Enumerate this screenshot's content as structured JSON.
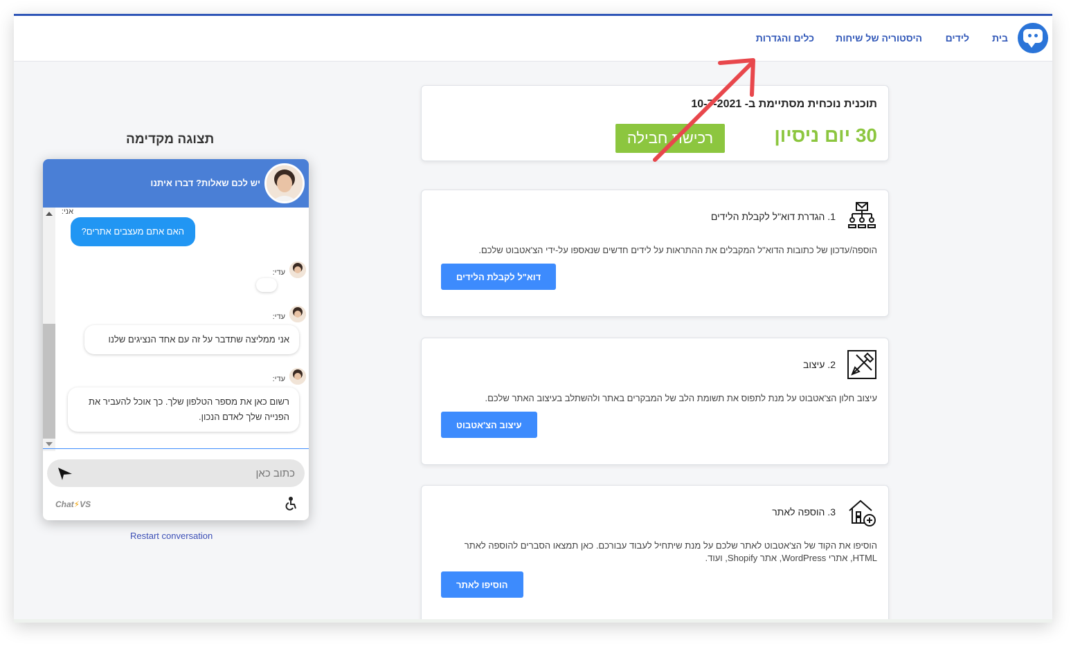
{
  "nav": {
    "items": [
      {
        "label": "בית"
      },
      {
        "label": "לידים"
      },
      {
        "label": "היסטוריה של שיחות"
      },
      {
        "label": "כלים והגדרות"
      }
    ]
  },
  "plan": {
    "title": "תוכנית נוכחית מסתיימת ב- 10-7-2021",
    "trial": "30 יום ניסיון",
    "buy_label": "רכישת חבילה"
  },
  "steps": [
    {
      "title": "1. הגדרת דוא\"ל לקבלת הלידים",
      "desc": "הוספה/עדכון של כתובות הדוא\"ל המקבלים את ההתראות על לידים חדשים שנאספו על-ידי הצ'אטבוט שלכם.",
      "button": "דוא\"ל לקבלת הלידים",
      "icon": "org-chart-mail-icon"
    },
    {
      "title": "2. עיצוב",
      "desc": "עיצוב חלון הצ'אטבוט על מנת לתפוס את תשומת הלב של המבקרים באתר ולהשתלב בעיצוב האתר שלכם.",
      "button": "עיצוב הצ'אטבוט",
      "icon": "design-brush-icon"
    },
    {
      "title": "3. הוספה לאתר",
      "desc": "הוסיפו את הקוד של הצ'אטבוט לאתר שלכם על מנת שיתחיל לעבוד עבורכם. כאן תמצאו הסברים להוספה לאתר HTML, אתרי WordPress, אתר Shopify, ועוד.",
      "button": "הוסיפו לאתר",
      "icon": "house-add-icon"
    }
  ],
  "preview": {
    "title": "תצוגה מקדימה",
    "header_text": "יש לכם שאלות? דברו איתנו",
    "me_label": "אני:",
    "bot_label": "עדי:",
    "messages": [
      {
        "text": "האם אתם מעצבים אתרים?"
      },
      {
        "text": ""
      },
      {
        "text": "אני ממליצה שתדבר על זה עם אחד הנציגים שלנו"
      },
      {
        "text": "רשום כאן את מספר הטלפון שלך. כך אוכל להעביר את הפנייה שלך לאדם הנכון."
      }
    ],
    "input_placeholder": "כתוב כאן",
    "brand_prefix": "Chat",
    "brand_bolt": "⚡",
    "brand_suffix": "VS",
    "restart": "Restart conversation"
  },
  "colors": {
    "accent": "#2f56b7",
    "trial_green": "#8cc63f",
    "button_blue": "#3d8bfd",
    "widget_header": "#4a7fd6",
    "annotation_arrow": "#e8474c"
  }
}
